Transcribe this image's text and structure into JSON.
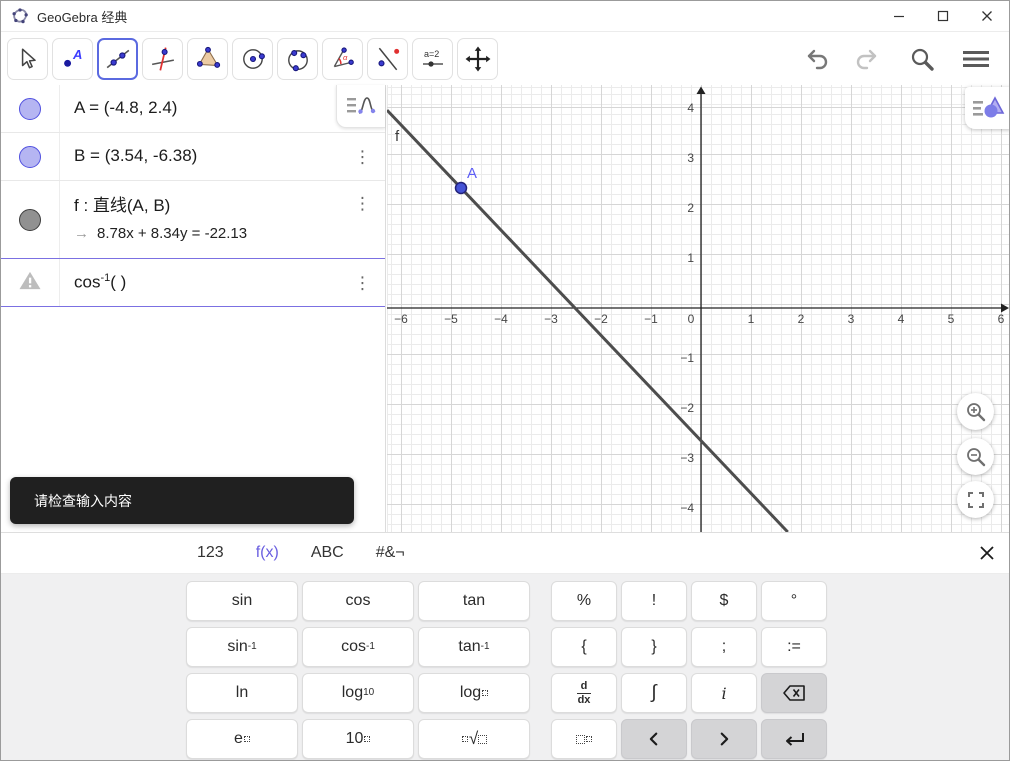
{
  "window": {
    "title": "GeoGebra 经典"
  },
  "toolbar": {
    "tools": [
      {
        "name": "move-tool",
        "selected": false
      },
      {
        "name": "point-tool",
        "selected": false
      },
      {
        "name": "line-tool",
        "selected": true
      },
      {
        "name": "perpendicular-line-tool",
        "selected": false
      },
      {
        "name": "polygon-tool",
        "selected": false
      },
      {
        "name": "circle-tool",
        "selected": false
      },
      {
        "name": "conic-tool",
        "selected": false
      },
      {
        "name": "angle-tool",
        "selected": false
      },
      {
        "name": "reflect-tool",
        "selected": false
      },
      {
        "name": "slider-tool",
        "selected": false,
        "label": "a=2"
      },
      {
        "name": "move-graphics-tool",
        "selected": false
      }
    ],
    "slider_label": "a=2"
  },
  "algebra": {
    "rows": [
      {
        "id": "A",
        "text": "A = (-4.8, 2.4)",
        "marble": "blue",
        "menu": false
      },
      {
        "id": "B",
        "text": "B = (3.54, -6.38)",
        "marble": "blue",
        "menu": true
      },
      {
        "id": "f",
        "text": "f : 直线(A, B)",
        "sub_arrow": "→",
        "sub_text": "8.78x + 8.34y = -22.13",
        "marble": "gray",
        "menu": true
      },
      {
        "id": "input",
        "parts": {
          "base": "cos",
          "sup": "-1",
          "tail": "( )"
        },
        "marble": "warning",
        "menu": true,
        "selected": true
      }
    ]
  },
  "toast": {
    "text": "请检查输入内容"
  },
  "graphics": {
    "x_labels": [
      -6,
      -5,
      -4,
      -3,
      -2,
      -1,
      0,
      1,
      2,
      3,
      4,
      5,
      6
    ],
    "y_labels": [
      4,
      3,
      2,
      1,
      -1,
      -2,
      -3,
      -4
    ],
    "points": [
      {
        "label": "A",
        "x": -4.8,
        "y": 2.4,
        "fill": "#4553d6",
        "stroke": "#22227a",
        "label_color": "#5d5df5"
      }
    ],
    "line": {
      "label": "f",
      "x1": -4.8,
      "y1": 2.4,
      "x2": 3.54,
      "y2": -6.38,
      "color": "#4d4d4d",
      "label_color": "#3a3a3a",
      "equation": "8.78x + 8.34y = -22.13"
    }
  },
  "keyboard": {
    "tabs": [
      {
        "label": "123",
        "active": false
      },
      {
        "label": "f(x)",
        "active": true
      },
      {
        "label": "ABC",
        "active": false
      },
      {
        "label": "#&¬",
        "active": false
      }
    ],
    "rows": [
      [
        {
          "t": "text",
          "v": "sin",
          "w": "wide",
          "name": "sin"
        },
        {
          "t": "text",
          "v": "cos",
          "w": "wide",
          "name": "cos"
        },
        {
          "t": "text",
          "v": "tan",
          "w": "wide",
          "name": "tan"
        },
        {
          "t": "text",
          "v": "%",
          "name": "percent"
        },
        {
          "t": "text",
          "v": "!",
          "name": "factorial"
        },
        {
          "t": "text",
          "v": "$",
          "name": "dollar"
        },
        {
          "t": "text",
          "v": "°",
          "name": "degree"
        }
      ],
      [
        {
          "t": "sup",
          "v": "sin",
          "s": "-1",
          "w": "wide",
          "name": "arcsin"
        },
        {
          "t": "sup",
          "v": "cos",
          "s": "-1",
          "w": "wide",
          "name": "arccos"
        },
        {
          "t": "sup",
          "v": "tan",
          "s": "-1",
          "w": "wide",
          "name": "arctan"
        },
        {
          "t": "text",
          "v": "{",
          "name": "brace-open"
        },
        {
          "t": "text",
          "v": "}",
          "name": "brace-close"
        },
        {
          "t": "text",
          "v": ";",
          "name": "semicolon"
        },
        {
          "t": "text",
          "v": ":=",
          "name": "assign"
        }
      ],
      [
        {
          "t": "text",
          "v": "ln",
          "w": "wide",
          "name": "ln"
        },
        {
          "t": "sub",
          "v": "log",
          "s": "10",
          "w": "wide",
          "name": "log10"
        },
        {
          "t": "subbox",
          "v": "log",
          "w": "wide",
          "name": "log-base"
        },
        {
          "t": "frac",
          "n": "d",
          "d": "dx",
          "name": "derivative"
        },
        {
          "t": "text",
          "v": "∫",
          "name": "integral",
          "big": true
        },
        {
          "t": "text",
          "v": "i",
          "name": "imaginary-i",
          "italic": true
        },
        {
          "t": "svg",
          "icon": "backspace",
          "name": "backspace",
          "gray": true
        }
      ],
      [
        {
          "t": "supbox",
          "v": "e",
          "w": "wide",
          "name": "e-power"
        },
        {
          "t": "supbox",
          "v": "10",
          "w": "wide",
          "name": "ten-power"
        },
        {
          "t": "root",
          "v": "√",
          "w": "wide",
          "name": "nth-root"
        },
        {
          "t": "idxbox",
          "name": "subscript"
        },
        {
          "t": "svg",
          "icon": "left",
          "name": "cursor-left",
          "gray": true
        },
        {
          "t": "svg",
          "icon": "right",
          "name": "cursor-right",
          "gray": true
        },
        {
          "t": "svg",
          "icon": "enter",
          "name": "enter",
          "gray": true
        }
      ]
    ]
  }
}
